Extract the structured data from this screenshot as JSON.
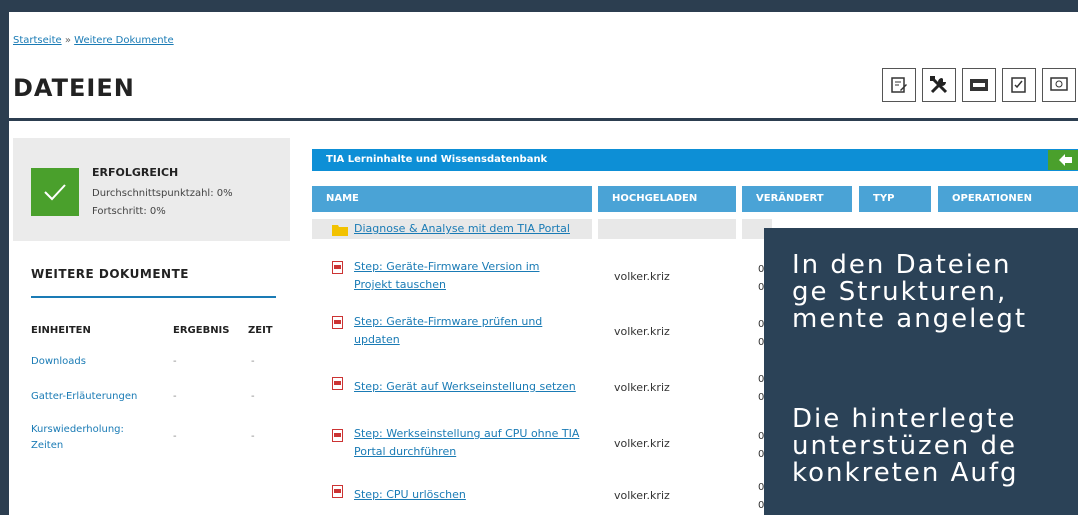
{
  "breadcrumb": {
    "home": "Startseite",
    "separator": "»",
    "current": "Weitere Dokumente"
  },
  "page_title": "DATEIEN",
  "toolbar": {
    "icons": [
      "edit-note-icon",
      "tools-icon",
      "badge-icon",
      "checklist-icon",
      "screen-icon"
    ]
  },
  "status": {
    "title": "ERFOLGREICH",
    "average_score": "Durchschnittspunktzahl: 0%",
    "progress": "Fortschritt: 0%",
    "color": "#4aa02c"
  },
  "documents": {
    "title": "WEITERE DOKUMENTE",
    "columns": [
      "EINHEITEN",
      "ERGEBNIS",
      "ZEIT"
    ],
    "units": [
      {
        "name": "Downloads",
        "result": "-",
        "time": "-"
      },
      {
        "name": "Gatter-Erläuterungen",
        "result": "-",
        "time": "-"
      },
      {
        "name": "Kurswiederholung: Zeiten",
        "result": "-",
        "time": "-"
      }
    ]
  },
  "table": {
    "title": "TIA Lerninhalte und Wissensdatenbank",
    "columns": [
      "NAME",
      "HOCHGELADEN",
      "VERÄNDERT",
      "TYP",
      "OPERATIONEN"
    ],
    "folder": {
      "name": "Diagnose & Analyse mit dem TIA Portal"
    },
    "rows": [
      {
        "name_line1": "Step: Geräte-Firmware Version im",
        "name_line2": "Projekt tauschen",
        "uploaded_by": "volker.kriz",
        "changed_a": "0",
        "changed_b": "0"
      },
      {
        "name_line1": "Step: Geräte-Firmware prüfen und",
        "name_line2": "updaten",
        "uploaded_by": "volker.kriz",
        "changed_a": "0",
        "changed_b": "0"
      },
      {
        "name_line1": "Step: Gerät auf Werkseinstellung setzen",
        "name_line2": "",
        "uploaded_by": "volker.kriz",
        "changed_a": "0",
        "changed_b": "0"
      },
      {
        "name_line1": "Step: Werkseinstellung auf CPU ohne TIA",
        "name_line2": "Portal durchführen",
        "uploaded_by": "volker.kriz",
        "changed_a": "0",
        "changed_b": "0"
      },
      {
        "name_line1": "Step: CPU urlöschen",
        "name_line2": "",
        "uploaded_by": "volker.kriz",
        "changed_a": "0",
        "changed_b": "0"
      }
    ],
    "accent_color": "#0d8fd6",
    "header_color": "#4aa3d6"
  },
  "overlay": {
    "p1": [
      "In den Dateien",
      "ge Strukturen,",
      "mente angelegt"
    ],
    "p2": [
      "Die hinterlegte",
      "unterstüzen de",
      "konkreten Aufg"
    ],
    "background": "#2b4257"
  }
}
